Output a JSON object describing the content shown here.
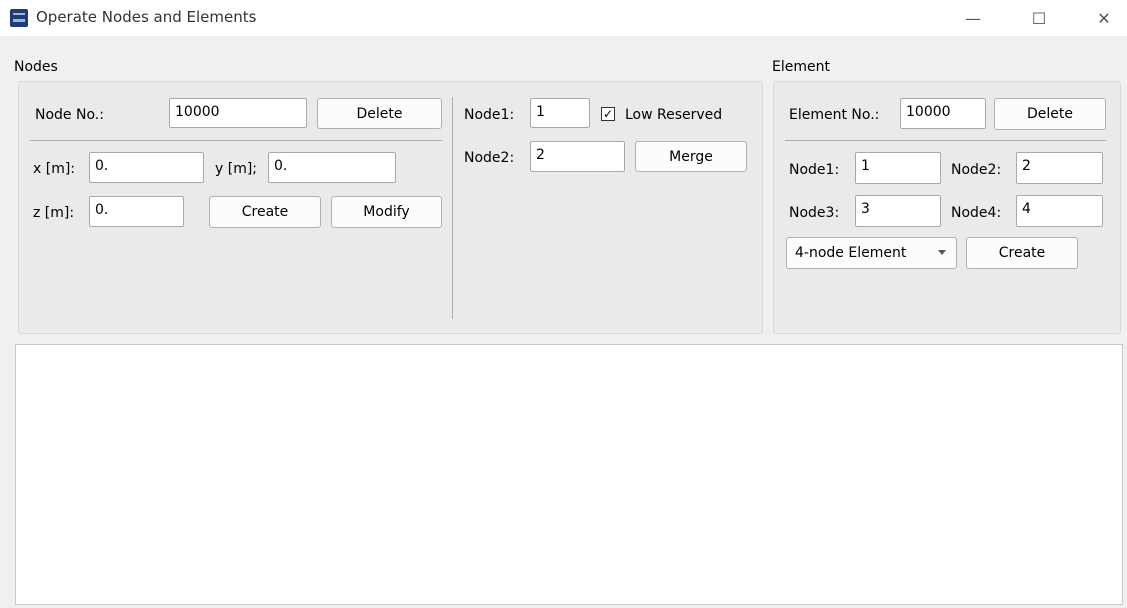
{
  "window": {
    "title": "Operate Nodes and Elements",
    "controls": {
      "minimize": "—",
      "maximize": "☐",
      "close": "✕"
    }
  },
  "nodes": {
    "group_label": "Nodes",
    "node_no_label": "Node No.:",
    "node_no_value": "10000",
    "delete_label": "Delete",
    "x_label": "x [m]:",
    "x_value": "0.",
    "y_label": "y [m];",
    "y_value": "0.",
    "z_label": "z [m]:",
    "z_value": "0.",
    "create_label": "Create",
    "modify_label": "Modify"
  },
  "merge": {
    "node1_label": "Node1:",
    "node1_value": "1",
    "low_reserved_label": "Low Reserved",
    "low_reserved_checked": true,
    "checkmark": "✓",
    "node2_label": "Node2:",
    "node2_value": "2",
    "merge_label": "Merge"
  },
  "element": {
    "group_label": "Element",
    "element_no_label": "Element No.:",
    "element_no_value": "10000",
    "delete_label": "Delete",
    "node1_label": "Node1:",
    "node1_value": "1",
    "node2_label": "Node2:",
    "node2_value": "2",
    "node3_label": "Node3:",
    "node3_value": "3",
    "node4_label": "Node4:",
    "node4_value": "4",
    "type_selected": "4-node Element",
    "create_label": "Create"
  },
  "output": {
    "text": ""
  }
}
